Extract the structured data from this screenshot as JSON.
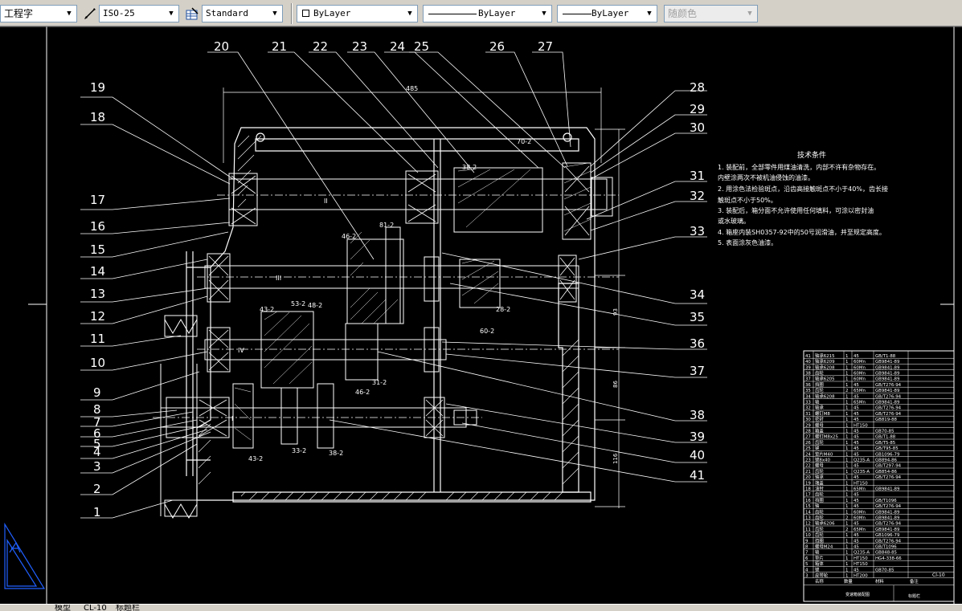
{
  "toolbar": {
    "text_style": "工程字",
    "dim_style": "ISO-25",
    "table_style": "Standard",
    "layer": "ByLayer",
    "linetype": "ByLayer",
    "lineweight": "ByLayer",
    "plot_style": "随颜色"
  },
  "status_tabs": [
    "模型",
    "CL-10",
    "标题栏"
  ],
  "drawing": {
    "part_numbers_top": [
      "20",
      "21",
      "22",
      "23",
      "24",
      "25",
      "26",
      "27"
    ],
    "part_numbers_left": [
      "19",
      "18",
      "17",
      "16",
      "15",
      "14",
      "13",
      "12",
      "11",
      "10",
      "9",
      "8",
      "7",
      "6",
      "5",
      "4",
      "3",
      "2",
      "1"
    ],
    "part_numbers_right": [
      "28",
      "29",
      "30",
      "31",
      "32",
      "33",
      "34",
      "35",
      "36",
      "37",
      "38",
      "39",
      "40",
      "41"
    ],
    "overall_dimension": "485",
    "shaft_labels": [
      "II",
      "III",
      "IV",
      "I"
    ],
    "gear_labels": [
      "70-2",
      "38-2",
      "81-2",
      "46-2",
      "43-2",
      "53-2",
      "48-2",
      "28-2",
      "60-2",
      "31-2",
      "46-2",
      "43-2",
      "33-2",
      "38-2"
    ],
    "tech_title": "技术条件",
    "tech_notes": [
      "1. 装配前，全部零件用煤油清洗，内部不许有杂物存在。",
      "   内壁涂两次不被机油侵蚀的油漆。",
      "2. 用涂色法检验斑点，沿齿高接触斑点不小于40%，齿长接",
      "   触斑点不小于50%。",
      "3. 装配后，箱分面不允许使用任何填料，可涂以密封油",
      "   或水玻璃。",
      "4. 箱座内装SH0357-92中的50号润滑油，并至规定高度。",
      "5. 表面涂灰色油漆。"
    ],
    "bom_rows": [
      [
        "41",
        "轴承6215",
        "1",
        "45",
        "GB/T1-88"
      ],
      [
        "40",
        "轴承6209",
        "1",
        "60Mn",
        "GB9841-89"
      ],
      [
        "39",
        "轴承6208",
        "1",
        "60Mn",
        "GB9841-89"
      ],
      [
        "38",
        "齿轮",
        "1",
        "60Mn",
        "GB9841-89"
      ],
      [
        "37",
        "轴承6205",
        "1",
        "60Mn",
        "GB9841-89"
      ],
      [
        "36",
        "挡圈",
        "1",
        "45",
        "GB/T276-94"
      ],
      [
        "35",
        "齿轮",
        "2",
        "65Mn",
        "GB9841-89"
      ],
      [
        "34",
        "轴承6208",
        "1",
        "45",
        "GB/T276-94"
      ],
      [
        "33",
        "轴",
        "1",
        "65Mn",
        "GB9841-89"
      ],
      [
        "32",
        "轴承",
        "1",
        "45",
        "GB/T276-94"
      ],
      [
        "31",
        "螺钉M8",
        "1",
        "45",
        "GB/T276-94"
      ],
      [
        "30",
        "密封",
        "1",
        "45",
        "GB819-88"
      ],
      [
        "29",
        "螺母",
        "1",
        "HT150",
        ""
      ],
      [
        "28",
        "箱盖",
        "1",
        "45",
        "GB70-85"
      ],
      [
        "27",
        "螺钉M8x25",
        "1",
        "45",
        "GB/T1-88"
      ],
      [
        "26",
        "齿轮",
        "1",
        "45",
        "GB/T5-85"
      ],
      [
        "25",
        "键",
        "1",
        "45",
        "GB/T95-85"
      ],
      [
        "24",
        "垫片M40",
        "1",
        "45",
        "GB1096-79"
      ],
      [
        "23",
        "键8x40",
        "1",
        "Q235-A",
        "GB894-86"
      ],
      [
        "22",
        "螺母",
        "1",
        "45",
        "GB/T297-94"
      ],
      [
        "21",
        "齿轮",
        "1",
        "Q235-A",
        "GB854-86"
      ],
      [
        "20",
        "轴承",
        "1",
        "45",
        "GB/T276-94"
      ],
      [
        "19",
        "端盖",
        "1",
        "HT150",
        ""
      ],
      [
        "18",
        "油封",
        "1",
        "65Mn",
        "GB9841-89"
      ],
      [
        "17",
        "齿轮",
        "1",
        "45",
        ""
      ],
      [
        "16",
        "挡圈",
        "1",
        "45",
        "GB/T1096"
      ],
      [
        "15",
        "轴",
        "1",
        "45",
        "GB/T276-94"
      ],
      [
        "14",
        "齿轮",
        "1",
        "60Mn",
        "GB9841-89"
      ],
      [
        "13",
        "齿轮",
        "2",
        "60Mn",
        "GB9841-89"
      ],
      [
        "12",
        "轴承6206",
        "1",
        "45",
        "GB/T276-94"
      ],
      [
        "11",
        "齿轮",
        "2",
        "65Mn",
        "GB9841-89"
      ],
      [
        "10",
        "齿轮",
        "1",
        "45",
        "GB1096-79"
      ],
      [
        "9",
        "挡圈",
        "1",
        "45",
        "GB/T276-94"
      ],
      [
        "8",
        "螺母M24",
        "1",
        "45",
        "GB/T1096"
      ],
      [
        "7",
        "轴",
        "1",
        "Q235-A",
        "GB848-85"
      ],
      [
        "6",
        "垫片",
        "1",
        "HT150",
        "HG4-338-66"
      ],
      [
        "5",
        "箱体",
        "1",
        "HT150",
        ""
      ],
      [
        "4",
        "键",
        "1",
        "45",
        "GB70-85"
      ],
      [
        "3",
        "皮带轮",
        "1",
        "HT200",
        ""
      ]
    ],
    "bom_footer": [
      "名称",
      "数量",
      "材料",
      "备注"
    ],
    "title_block_left": "变速箱装配图",
    "title_block_right": "Cl-10",
    "title_block_label": "标题栏"
  }
}
